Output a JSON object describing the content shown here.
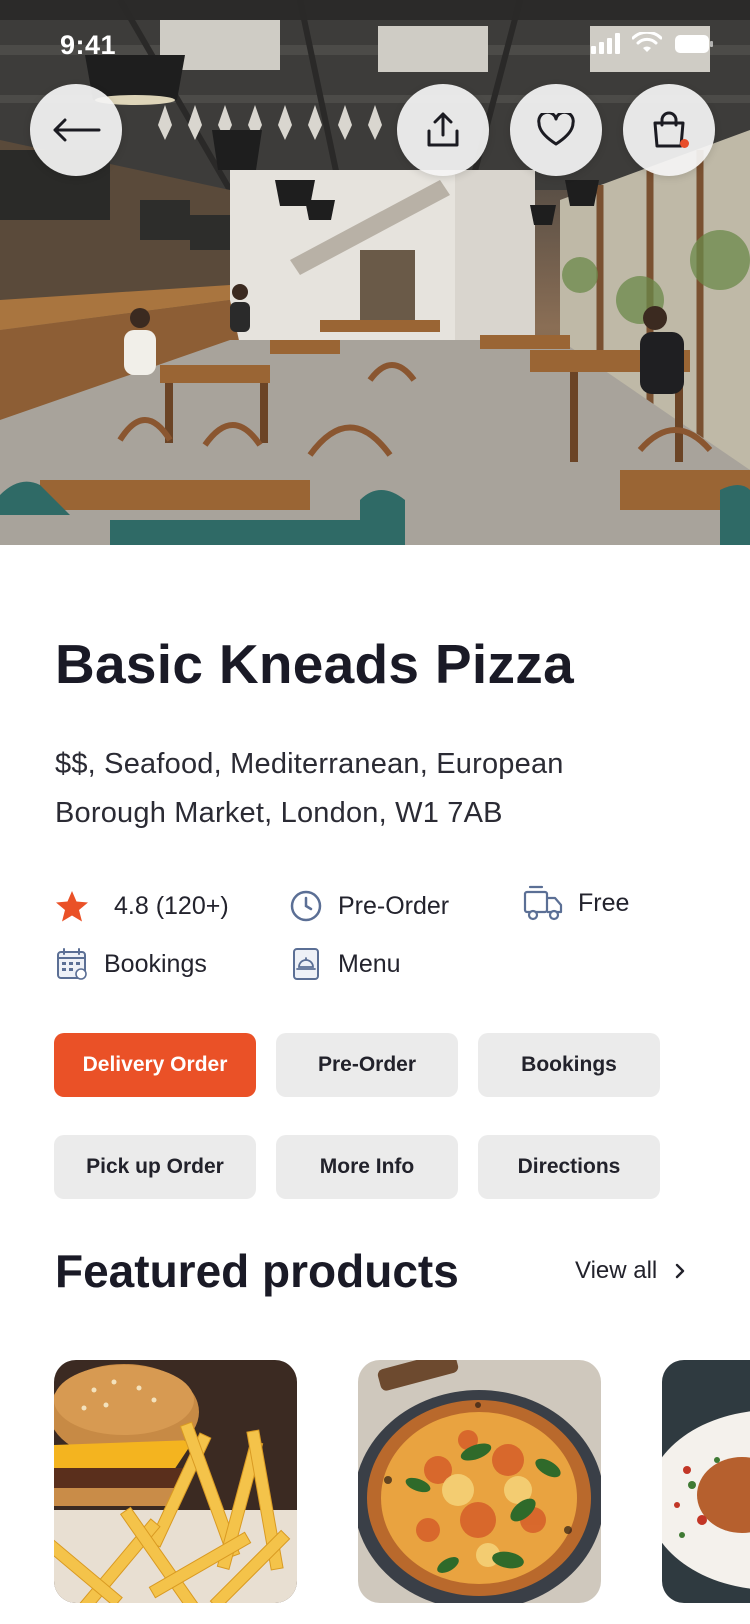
{
  "status_bar": {
    "time": "9:41"
  },
  "hero": {
    "image": "restaurant-interior-photo",
    "buttons": [
      {
        "name": "back-button",
        "icon": "arrow-left-icon"
      },
      {
        "name": "share-button",
        "icon": "share-icon"
      },
      {
        "name": "favorite-button",
        "icon": "heart-icon"
      },
      {
        "name": "cart-button",
        "icon": "shopping-bag-icon"
      }
    ]
  },
  "restaurant": {
    "name": "Basic Kneads Pizza",
    "tags": "$$, Seafood, Mediterranean, European",
    "address": "Borough Market, London, W1 7AB"
  },
  "info": {
    "rating": "4.8 (120+)",
    "pre_order": "Pre-Order",
    "delivery_fee": "Free",
    "bookings": "Bookings",
    "menu": "Menu"
  },
  "actions": {
    "delivery_order": "Delivery Order",
    "pre_order": "Pre-Order",
    "bookings": "Bookings",
    "pick_up_order": "Pick up Order",
    "more_info": "More Info",
    "directions": "Directions"
  },
  "featured": {
    "title": "Featured products",
    "view_all": "View all",
    "products": [
      {
        "image": "burger-and-fries-photo"
      },
      {
        "image": "margherita-pizza-photo"
      },
      {
        "image": "pasta-dish-photo"
      }
    ]
  },
  "colors": {
    "accent": "#ea5127",
    "chip_bg": "#ebebeb",
    "text_dark": "#1a1a26",
    "icon_blue": "#5b6f95"
  }
}
